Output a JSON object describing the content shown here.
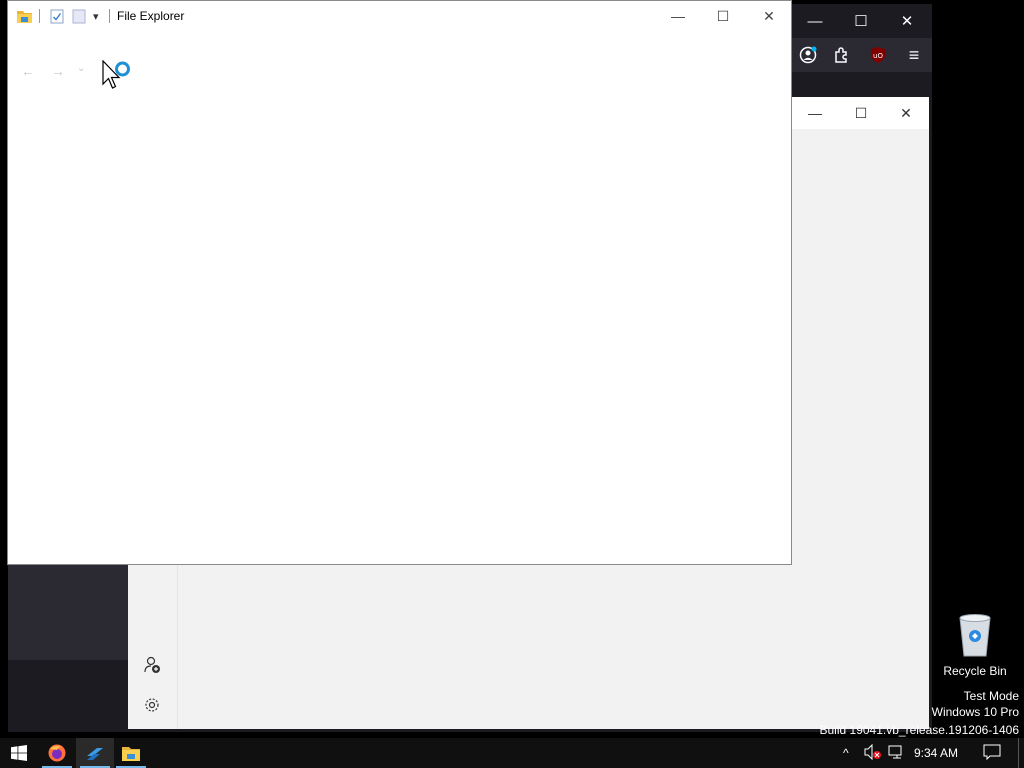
{
  "file_explorer": {
    "title": "File Explorer",
    "quick_access_dropdown": "▾",
    "caption": {
      "minimize": "—",
      "maximize": "☐",
      "close": "✕"
    },
    "nav": {
      "back": "←",
      "forward": "→",
      "recent": "⌄"
    }
  },
  "browser": {
    "caption": {
      "minimize": "—",
      "maximize": "☐",
      "close": "✕"
    },
    "toolbar_menu": "≡"
  },
  "settings": {
    "caption": {
      "minimize": "—",
      "maximize": "☐",
      "close": "✕"
    }
  },
  "desktop": {
    "recycle_bin": "Recycle Bin",
    "watermark": {
      "line1": "Test Mode",
      "line2": "Windows 10 Pro",
      "line3": "Build 19041.vb_release.191206-1406"
    }
  },
  "taskbar": {
    "clock": "9:34 AM",
    "tray_chevron": "^",
    "accent": "#76b9ed"
  },
  "colors": {
    "browser_dark": "#1c1b22",
    "explorer_bg": "#ffffff",
    "settings_bg": "#f2f2f2",
    "taskbar_bg": "#101010"
  }
}
